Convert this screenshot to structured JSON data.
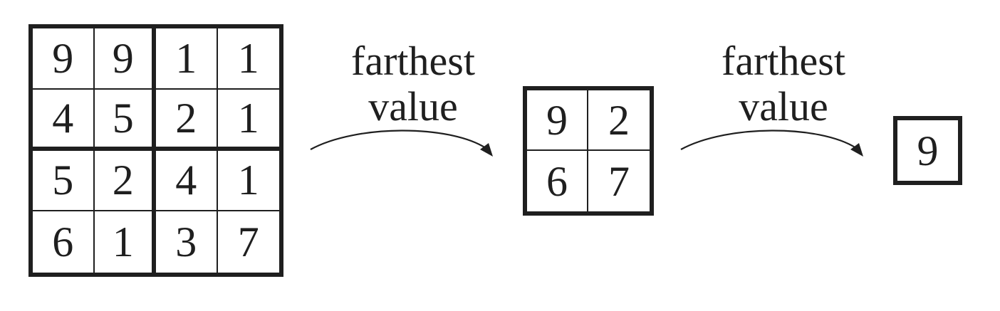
{
  "input_grid": {
    "cells": [
      [
        "9",
        "9",
        "1",
        "1"
      ],
      [
        "4",
        "5",
        "2",
        "1"
      ],
      [
        "5",
        "2",
        "4",
        "1"
      ],
      [
        "6",
        "1",
        "3",
        "7"
      ]
    ]
  },
  "arrow_1": {
    "line1": "farthest",
    "line2": "value"
  },
  "pooled_grid": {
    "cells": [
      [
        "9",
        "2"
      ],
      [
        "6",
        "7"
      ]
    ]
  },
  "arrow_2": {
    "line1": "farthest",
    "line2": "value"
  },
  "final_grid": {
    "cells": [
      [
        "9"
      ]
    ]
  }
}
